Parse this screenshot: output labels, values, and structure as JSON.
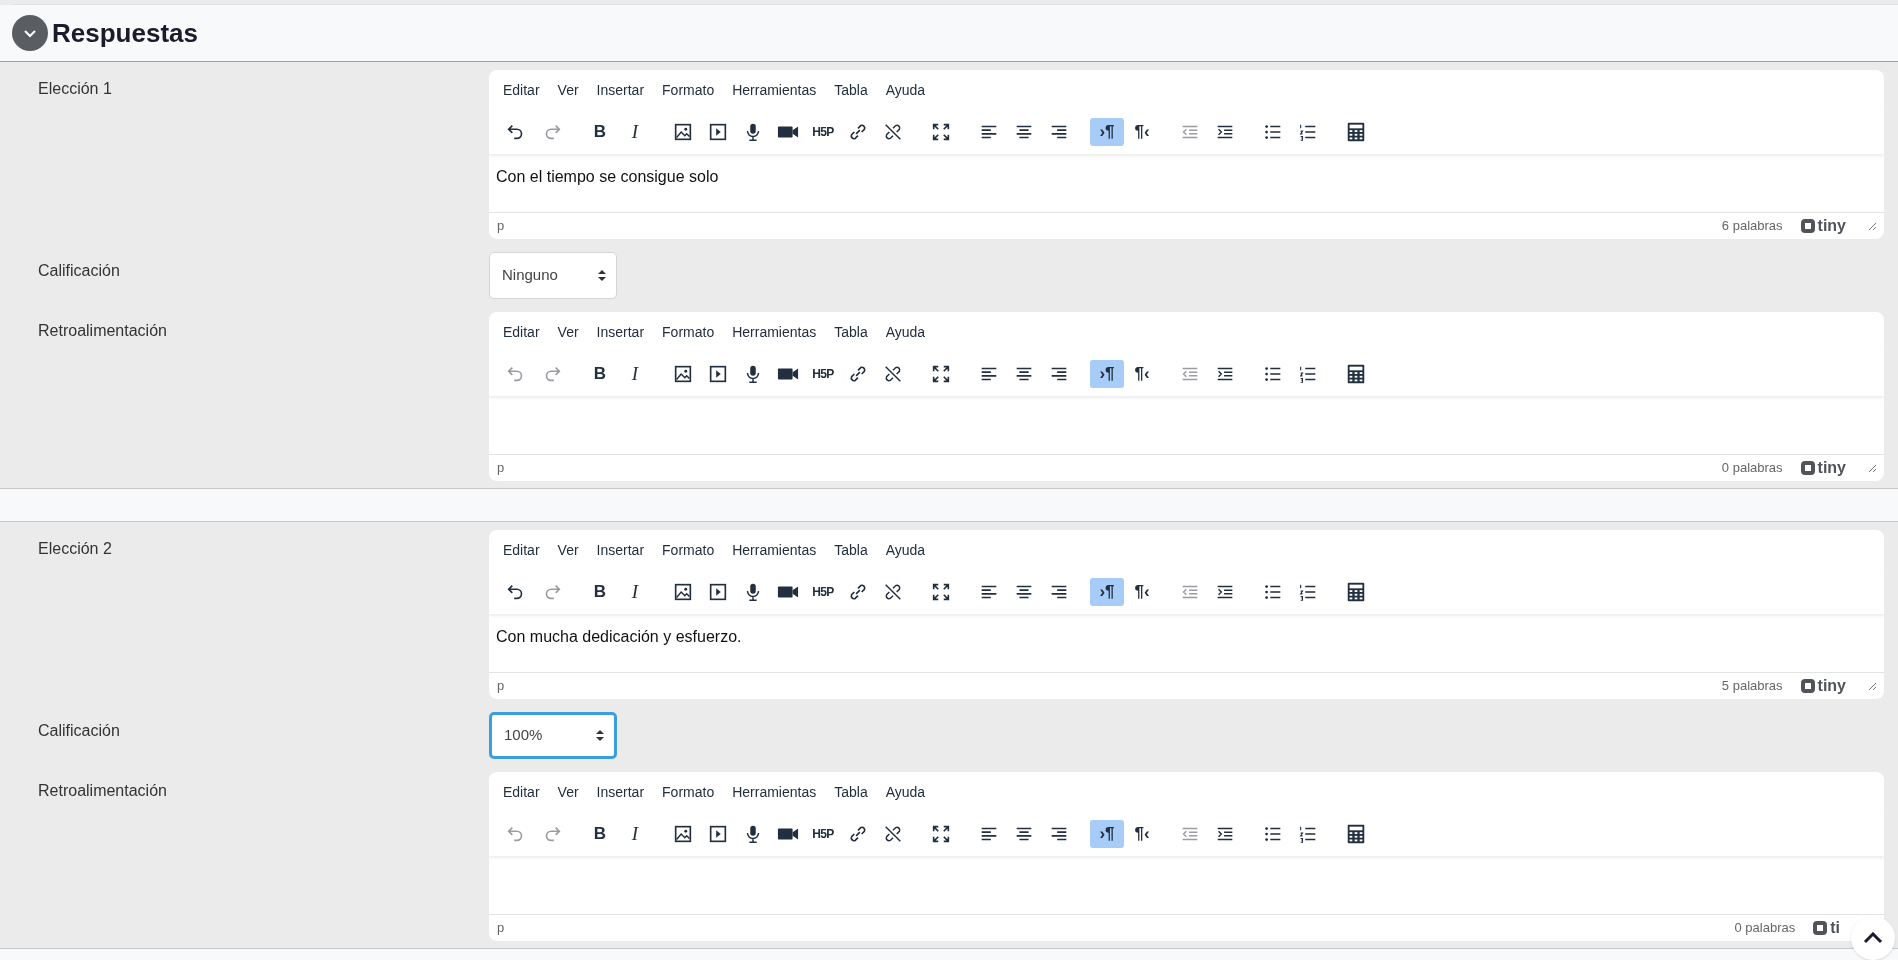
{
  "header": {
    "title": "Respuestas",
    "expanded": true
  },
  "toolbar": [
    [
      {
        "kind": "bold",
        "disabled": false,
        "selected": false
      },
      {
        "kind": "italic",
        "disabled": false,
        "selected": false
      }
    ],
    [
      {
        "kind": "image",
        "disabled": false,
        "selected": false
      },
      {
        "kind": "media",
        "disabled": false,
        "selected": false
      },
      {
        "kind": "mic",
        "disabled": false,
        "selected": false
      },
      {
        "kind": "video",
        "disabled": false,
        "selected": false
      },
      {
        "kind": "h5p",
        "disabled": false,
        "selected": false
      },
      {
        "kind": "link",
        "disabled": false,
        "selected": false
      },
      {
        "kind": "unlink",
        "disabled": false,
        "selected": false
      }
    ],
    [
      {
        "kind": "fullscreen",
        "disabled": false,
        "selected": false
      }
    ],
    [
      {
        "kind": "align-left",
        "disabled": false,
        "selected": false
      },
      {
        "kind": "align-center",
        "disabled": false,
        "selected": false
      },
      {
        "kind": "align-right",
        "disabled": false,
        "selected": false
      }
    ],
    [
      {
        "kind": "ltr",
        "disabled": false,
        "selected": true
      },
      {
        "kind": "rtl",
        "disabled": false,
        "selected": false
      }
    ],
    [
      {
        "kind": "outdent",
        "disabled": true,
        "selected": false
      },
      {
        "kind": "indent",
        "disabled": false,
        "selected": false
      }
    ],
    [
      {
        "kind": "bullets",
        "disabled": false,
        "selected": false
      },
      {
        "kind": "numbers",
        "disabled": false,
        "selected": false
      }
    ],
    [
      {
        "kind": "calculator",
        "disabled": false,
        "selected": false
      }
    ]
  ],
  "choices": [
    {
      "fields": [
        {
          "kind": "editor",
          "label": "Elección 1",
          "menu": [
            "Editar",
            "Ver",
            "Insertar",
            "Formato",
            "Herramientas",
            "Tabla",
            "Ayuda"
          ],
          "button_labels": [
            "B",
            "I",
            "H5P",
            "›¶",
            "¶‹"
          ],
          "undo_disabled": false,
          "redo_disabled": true,
          "content": "Con el tiempo se consigue solo",
          "path": "p",
          "word_count": "6 palabras",
          "brand": "tiny"
        },
        {
          "kind": "select",
          "label": "Calificación",
          "value": "Ninguno",
          "focused": false
        },
        {
          "kind": "editor",
          "label": "Retroalimentación",
          "menu": [
            "Editar",
            "Ver",
            "Insertar",
            "Formato",
            "Herramientas",
            "Tabla",
            "Ayuda"
          ],
          "button_labels": [
            "B",
            "I",
            "H5P",
            "›¶",
            "¶‹"
          ],
          "undo_disabled": true,
          "redo_disabled": true,
          "path": "p",
          "word_count": "0 palabras",
          "brand": "tiny"
        }
      ]
    },
    {
      "fields": [
        {
          "kind": "editor",
          "label": "Elección 2",
          "menu": [
            "Editar",
            "Ver",
            "Insertar",
            "Formato",
            "Herramientas",
            "Tabla",
            "Ayuda"
          ],
          "button_labels": [
            "B",
            "I",
            "H5P",
            "›¶",
            "¶‹"
          ],
          "undo_disabled": false,
          "redo_disabled": true,
          "content": "Con mucha dedicación y esfuerzo.",
          "path": "p",
          "word_count": "5 palabras",
          "brand": "tiny"
        },
        {
          "kind": "select",
          "label": "Calificación",
          "value": "100%",
          "focused": true
        },
        {
          "kind": "editor",
          "label": "Retroalimentación",
          "menu": [
            "Editar",
            "Ver",
            "Insertar",
            "Formato",
            "Herramientas",
            "Tabla",
            "Ayuda"
          ],
          "button_labels": [
            "B",
            "I",
            "H5P",
            "›¶",
            "¶‹"
          ],
          "undo_disabled": true,
          "redo_disabled": true,
          "path": "p",
          "word_count": "0 palabras",
          "brand": "ti"
        }
      ]
    }
  ]
}
